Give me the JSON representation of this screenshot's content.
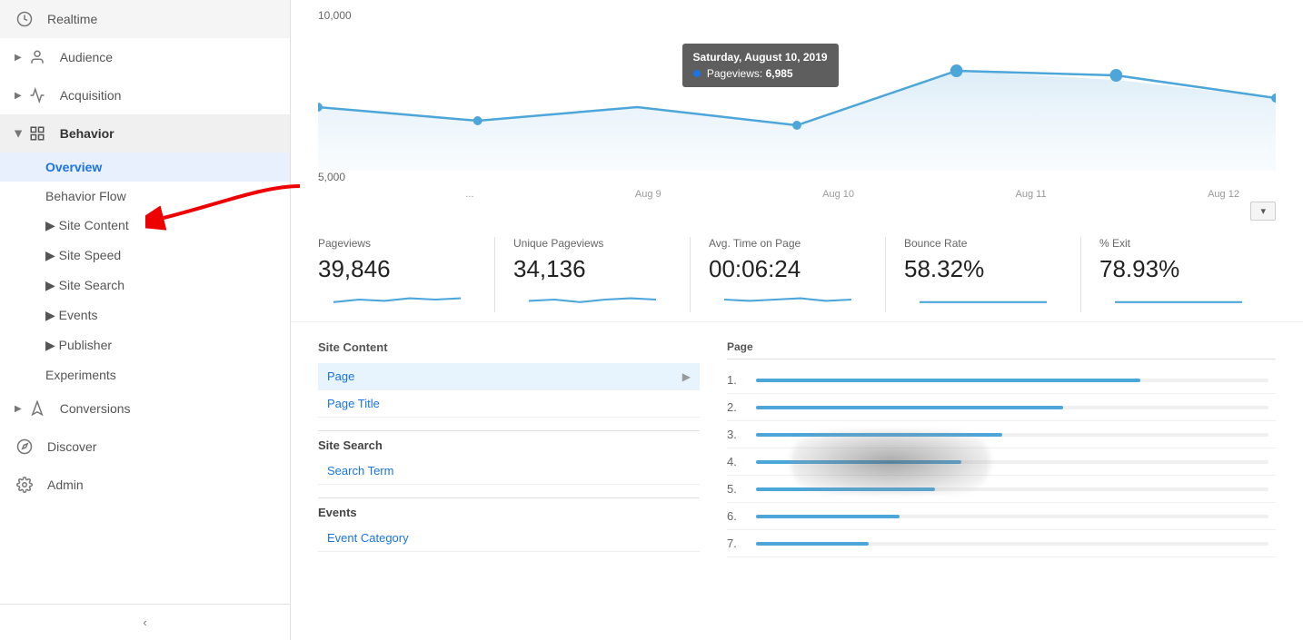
{
  "sidebar": {
    "items": [
      {
        "id": "realtime",
        "label": "Realtime",
        "icon": "clock-icon",
        "indent": 0,
        "hasArrow": true
      },
      {
        "id": "audience",
        "label": "Audience",
        "icon": "person-icon",
        "indent": 0,
        "hasArrow": true
      },
      {
        "id": "acquisition",
        "label": "Acquisition",
        "icon": "acquisition-icon",
        "indent": 0,
        "hasArrow": true
      },
      {
        "id": "behavior",
        "label": "Behavior",
        "icon": "behavior-icon",
        "indent": 0,
        "hasArrow": true,
        "expanded": true
      },
      {
        "id": "overview",
        "label": "Overview",
        "indent": 1,
        "active": true
      },
      {
        "id": "behavior-flow",
        "label": "Behavior Flow",
        "indent": 1
      },
      {
        "id": "site-content",
        "label": "Site Content",
        "indent": 1,
        "hasArrow": true
      },
      {
        "id": "site-speed",
        "label": "Site Speed",
        "indent": 1,
        "hasArrow": true
      },
      {
        "id": "site-search",
        "label": "Site Search",
        "indent": 1,
        "hasArrow": true
      },
      {
        "id": "events",
        "label": "Events",
        "indent": 1,
        "hasArrow": true
      },
      {
        "id": "publisher",
        "label": "Publisher",
        "indent": 1,
        "hasArrow": true
      },
      {
        "id": "experiments",
        "label": "Experiments",
        "indent": 1
      },
      {
        "id": "conversions",
        "label": "Conversions",
        "icon": "conversions-icon",
        "indent": 0,
        "hasArrow": true
      },
      {
        "id": "discover",
        "label": "Discover",
        "icon": "discover-icon",
        "indent": 0
      },
      {
        "id": "admin",
        "label": "Admin",
        "icon": "admin-icon",
        "indent": 0
      }
    ],
    "collapse_label": "‹"
  },
  "chart": {
    "y_labels": [
      "10,000",
      "5,000"
    ],
    "x_labels": [
      "Aug 9",
      "Aug 10",
      "Aug 11",
      "Aug 12"
    ],
    "tooltip": {
      "title": "Saturday, August 10, 2019",
      "metric": "Pageviews",
      "value": "6,985"
    }
  },
  "stats": [
    {
      "id": "pageviews",
      "label": "Pageviews",
      "value": "39,846"
    },
    {
      "id": "unique-pageviews",
      "label": "Unique Pageviews",
      "value": "34,136"
    },
    {
      "id": "avg-time",
      "label": "Avg. Time on Page",
      "value": "00:06:24"
    },
    {
      "id": "bounce-rate",
      "label": "Bounce Rate",
      "value": "58.32%"
    },
    {
      "id": "exit",
      "label": "% Exit",
      "value": "78.93%"
    }
  ],
  "left_panel": {
    "site_content": {
      "heading": "Site Content",
      "items": [
        {
          "id": "page",
          "label": "Page",
          "selected": true
        },
        {
          "id": "page-title",
          "label": "Page Title"
        }
      ]
    },
    "site_search": {
      "heading": "Site Search",
      "items": [
        {
          "id": "search-term",
          "label": "Search Term"
        }
      ]
    },
    "events": {
      "heading": "Events",
      "items": [
        {
          "id": "event-category",
          "label": "Event Category"
        }
      ]
    }
  },
  "right_panel": {
    "heading": "Page",
    "rows": [
      {
        "num": "1.",
        "bar_pct": 75
      },
      {
        "num": "2.",
        "bar_pct": 60
      },
      {
        "num": "3.",
        "bar_pct": 48
      },
      {
        "num": "4.",
        "bar_pct": 40
      },
      {
        "num": "5.",
        "bar_pct": 35
      },
      {
        "num": "6.",
        "bar_pct": 28
      },
      {
        "num": "7.",
        "bar_pct": 22
      }
    ]
  },
  "colors": {
    "active_nav": "#1a73e8",
    "active_nav_bg": "#e8f0fe",
    "link": "#1a73e8",
    "chart_line": "#4da6d9",
    "chart_fill": "#d6eaf8"
  }
}
